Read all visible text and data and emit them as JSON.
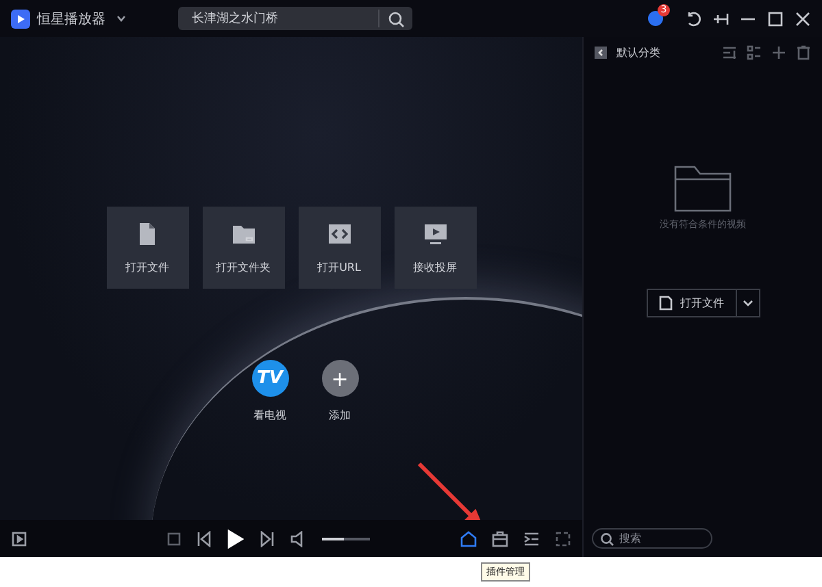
{
  "app": {
    "name": "恒星播放器",
    "search_value": "长津湖之水门桥",
    "badge": "3"
  },
  "actions": [
    {
      "kind": "file",
      "label": "打开文件"
    },
    {
      "kind": "folder",
      "label": "打开文件夹"
    },
    {
      "kind": "url",
      "label": "打开URL"
    },
    {
      "kind": "cast",
      "label": "接收投屏"
    }
  ],
  "shortcuts": [
    {
      "kind": "tv",
      "label": "看电视",
      "icon_text": "TV"
    },
    {
      "kind": "add",
      "label": "添加",
      "icon_text": "+"
    }
  ],
  "sidebar": {
    "title": "默认分类",
    "empty_text": "没有符合条件的视频",
    "open_button": "打开文件",
    "search_placeholder": "搜索"
  },
  "player": {
    "volume": {
      "level": 0.45
    }
  },
  "tooltip": "插件管理"
}
